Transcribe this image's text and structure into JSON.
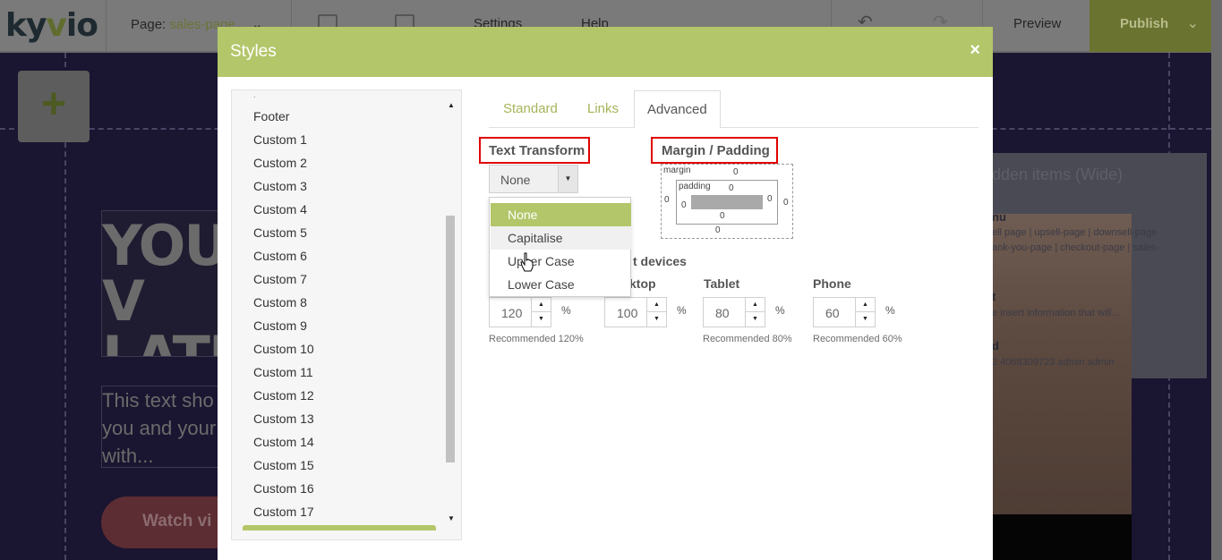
{
  "topbar": {
    "logo": "kyvio",
    "page_label": "Page:",
    "page_value": "sales-page",
    "settings": "Settings",
    "help": "Help",
    "preview": "Preview",
    "publish": "Publish"
  },
  "canvas": {
    "hero_title_lines": [
      "YOU V",
      "LATES"
    ],
    "hero_text_lines": [
      "This text sho",
      "you and your",
      "with..."
    ],
    "watch_button": "Watch vi",
    "hidden_title": "dden items (Wide)",
    "hidden_items": [
      {
        "head": "nu",
        "detail_1": "ell page | upsell-page | downsell-page",
        "detail_2": "ank-you-page | checkout-page | sales-"
      },
      {
        "head": "t",
        "detail_1": "e insert information that will..."
      },
      {
        "head": "d",
        "detail_1": "2 4068309723 admin admin"
      }
    ]
  },
  "modal": {
    "title": "Styles",
    "close": "×",
    "style_list": [
      "Footer",
      "Custom 1",
      "Custom 2",
      "Custom 3",
      "Custom 4",
      "Custom 5",
      "Custom 6",
      "Custom 7",
      "Custom 8",
      "Custom 9",
      "Custom 10",
      "Custom 11",
      "Custom 12",
      "Custom 13",
      "Custom 14",
      "Custom 15",
      "Custom 16",
      "Custom 17"
    ],
    "tabs": [
      "Standard",
      "Links",
      "Advanced"
    ],
    "active_tab": "Advanced",
    "text_transform": {
      "label": "Text Transform",
      "value": "None",
      "options": [
        "None",
        "Capitalise",
        "Upper Case",
        "Lower Case"
      ],
      "selected_option": "None",
      "hovered_option": "Capitalise"
    },
    "margin_padding": {
      "label": "Margin / Padding",
      "margin_label": "margin",
      "padding_label": "padding",
      "margin": {
        "top": "0",
        "right": "0",
        "bottom": "0",
        "left": "0"
      },
      "padding": {
        "top": "0",
        "right": "0",
        "bottom": "0",
        "left": "0"
      }
    },
    "devices": {
      "label_visible": "t devices",
      "columns": [
        {
          "label": "",
          "value": "120",
          "unit": "%",
          "recommended": "Recommended 120%"
        },
        {
          "label": "ktop",
          "value": "100",
          "unit": "%",
          "recommended": ""
        },
        {
          "label": "Tablet",
          "value": "80",
          "unit": "%",
          "recommended": "Recommended 80%"
        },
        {
          "label": "Phone",
          "value": "60",
          "unit": "%",
          "recommended": "Recommended 60%"
        }
      ]
    }
  },
  "colors": {
    "accent": "#b3c66a",
    "highlight_box": "#e00000",
    "canvas_bg": "#1a1530"
  }
}
